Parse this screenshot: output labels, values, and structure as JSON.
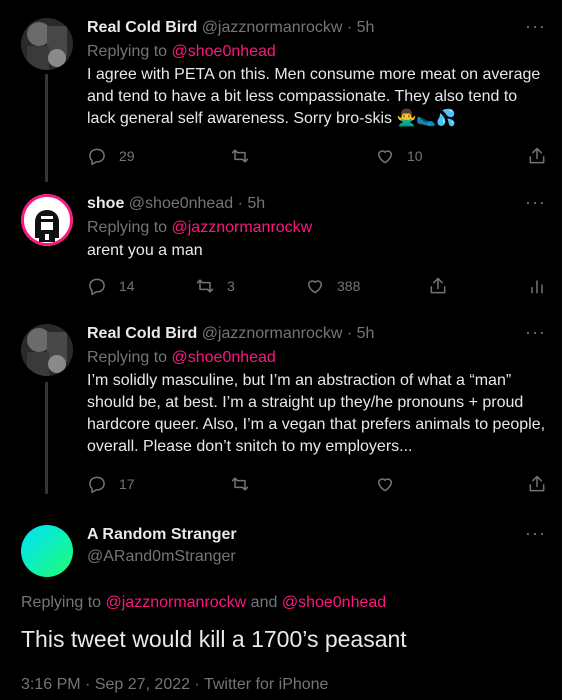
{
  "replies": [
    {
      "author": "Real Cold Bird",
      "handle": "@jazznormanrockw",
      "sep": "·",
      "time": "5h",
      "replying_label": "Replying to ",
      "replying_to": "@shoe0nhead",
      "text": "I agree with PETA on this. Men consume more meat on average and tend to have a bit less compassionate. They also tend to lack general self awareness. Sorry bro-skis 🙅‍♂️🥿💦",
      "replies": "29",
      "retweets": "",
      "likes": "10",
      "avatar": "photo-avatar-dark"
    },
    {
      "author": "shoe",
      "handle": "@shoe0nhead",
      "sep": "·",
      "time": "5h",
      "replying_label": "Replying to ",
      "replying_to": "@jazznormanrockw",
      "text": "arent you a man",
      "replies": "14",
      "retweets": "3",
      "likes": "388",
      "avatar": "cartoon-avatar-pink-border"
    },
    {
      "author": "Real Cold Bird",
      "handle": "@jazznormanrockw",
      "sep": "·",
      "time": "5h",
      "replying_label": "Replying to ",
      "replying_to": "@shoe0nhead",
      "text": "I’m solidly masculine, but I’m an abstraction of what a “man” should be, at best. I’m a straight up they/he pronouns + proud hardcore queer. Also, I’m a vegan that prefers animals to people, overall. Please don’t snitch to my employers...",
      "replies": "17",
      "retweets": "",
      "likes": "",
      "avatar": "photo-avatar-dark"
    }
  ],
  "main": {
    "author": "A Random Stranger",
    "handle": "@ARand0mStranger",
    "replying_label": "Replying to ",
    "replying_to_1": "@jazznormanrockw",
    "replying_and": " and ",
    "replying_to_2": "@shoe0nhead",
    "text": "This tweet would kill a 1700’s peasant",
    "time": "3:16 PM",
    "date": "Sep 27, 2022",
    "client": "Twitter for iPhone",
    "sep": " · ",
    "avatar_colors": [
      "#00e0ff",
      "#1dff70"
    ]
  },
  "colors": {
    "background": "#000000",
    "text": "#e7e9ea",
    "secondary": "#71767b",
    "mention": "#f91880"
  }
}
